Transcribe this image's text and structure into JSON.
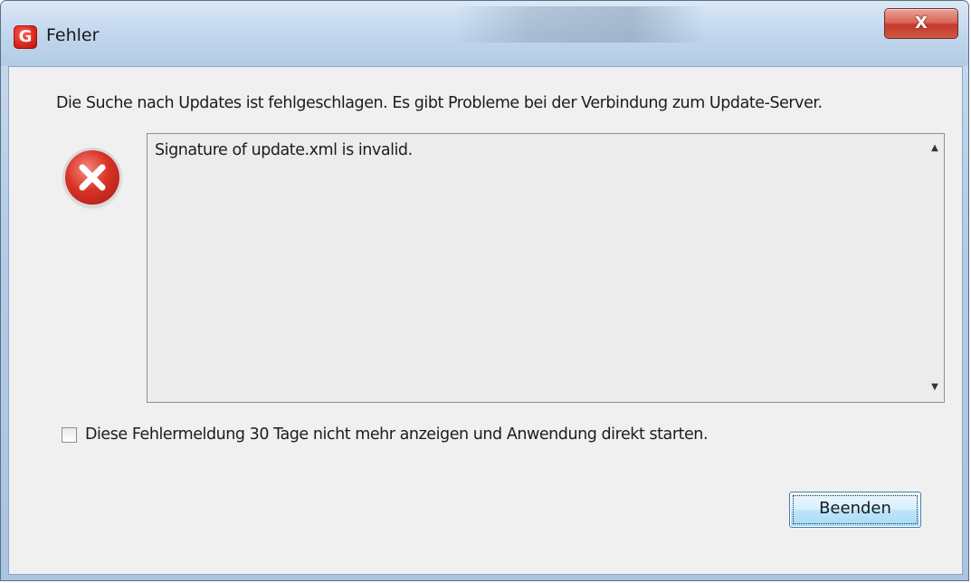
{
  "window": {
    "title": "Fehler",
    "app_icon_letter": "G",
    "close_label": "X"
  },
  "dialog": {
    "message": "Die Suche nach Updates ist fehlgeschlagen. Es gibt Probleme bei der Verbindung zum Update-Server.",
    "icon": "error-icon",
    "details": "Signature of update.xml is invalid.",
    "checkbox": {
      "label": "Diese Fehlermeldung 30 Tage nicht mehr anzeigen und Anwendung direkt starten.",
      "checked": false
    },
    "button_label": "Beenden"
  },
  "colors": {
    "accent_error": "#d83227",
    "close_button": "#c4392a",
    "focus_button_border": "#3c7fb1"
  }
}
